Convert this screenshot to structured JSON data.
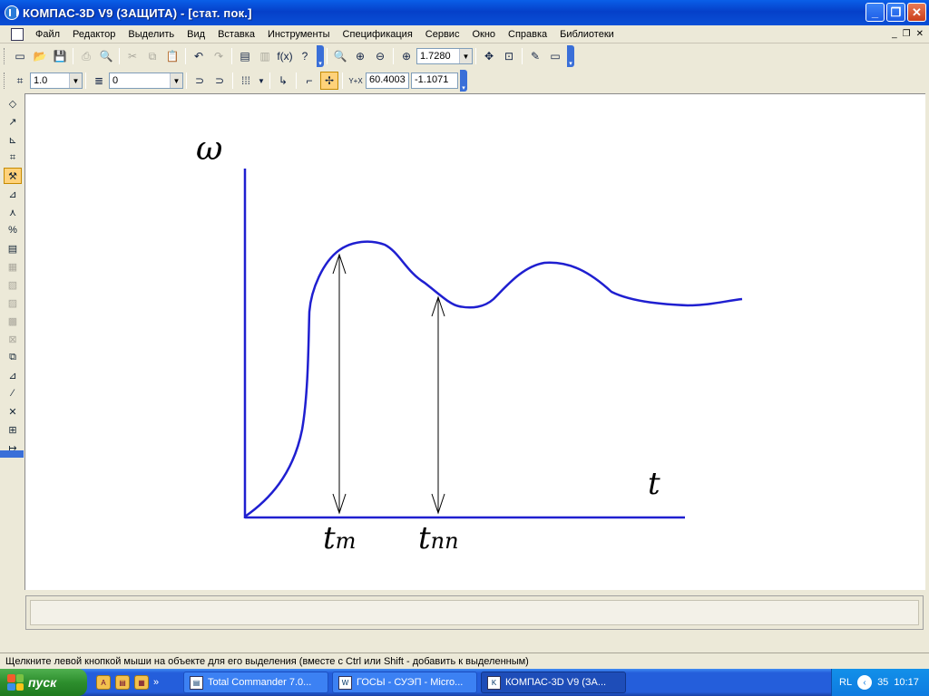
{
  "window": {
    "title": "КОМПАС-3D V9 (ЗАЩИТА) - [стат. пок.]",
    "minimize": "_",
    "maximize": "❐",
    "close": "✕"
  },
  "menu": {
    "items": [
      "Файл",
      "Редактор",
      "Выделить",
      "Вид",
      "Вставка",
      "Инструменты",
      "Спецификация",
      "Сервис",
      "Окно",
      "Справка",
      "Библиотеки"
    ]
  },
  "toolbar1": {
    "zoom_value": "1.7280",
    "fx_label": "f(x)"
  },
  "toolbar2": {
    "scale_value": "1.0",
    "layer_value": "0",
    "coord_x": "60.4003",
    "coord_y": "-1.1071",
    "coord_label": "Y+X"
  },
  "drawing": {
    "y_axis_label": "ω",
    "x_axis_label": "t",
    "tm_label_main": "t",
    "tm_label_sub": "m",
    "tpp_label_main": "t",
    "tpp_label_sub": "пп",
    "curve_color": "#1f1fd0",
    "line_color": "#1f1fd0"
  },
  "status": {
    "hint": "Щелкните левой кнопкой мыши на объекте для его выделения (вместе с Ctrl или Shift - добавить к выделенным)"
  },
  "taskbar": {
    "start_label": "пуск",
    "tasks": [
      {
        "label": "Total Commander 7.0..."
      },
      {
        "label": "ГОСЫ - СУЭП - Micro..."
      },
      {
        "label": "КОМПАС-3D V9 (ЗА..."
      }
    ],
    "lang": "RL",
    "clock": "10:17"
  }
}
